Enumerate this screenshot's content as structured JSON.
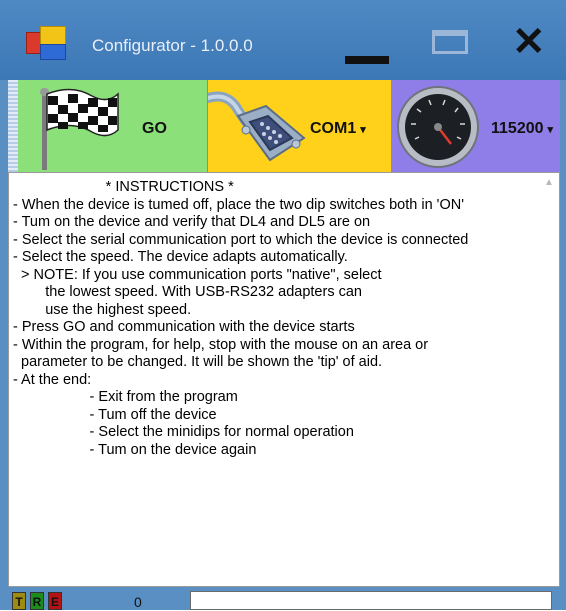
{
  "window": {
    "title": "Configurator - 1.0.0.0",
    "close_glyph": "✕"
  },
  "toolbar": {
    "go_label": "GO",
    "port_label": "COM1",
    "speed_label": "115200",
    "caret": "▾"
  },
  "instructions": {
    "text": "                       * INSTRUCTIONS *\n- When the device is tumed off, place the two dip switches both in 'ON'\n- Tum on the device and verify that DL4 and DL5 are on\n- Select the serial communication port to which the device is connected\n- Select the speed. The device adapts automatically.\n  > NOTE: If you use communication ports \"native\", select\n        the lowest speed. With USB-RS232 adapters can\n        use the highest speed.\n- Press GO and communication with the device starts\n- Within the program, for help, stop with the mouse on an area or\n  parameter to be changed. It will be shown the 'tip' of aid.\n- At the end:\n                   - Exit from the program\n                   - Tum off the device\n                   - Select the minidips for normal operation\n                   - Tum on the device again"
  },
  "statusbar": {
    "led_t": "T",
    "led_r": "R",
    "led_e": "E",
    "counter": "0",
    "field_value": ""
  },
  "icons": {
    "app": "app-icon",
    "flag": "checkered-flag-icon",
    "serial": "serial-connector-icon",
    "gauge": "speed-gauge-icon"
  },
  "colors": {
    "go_segment": "#8be07a",
    "port_segment": "#ffd11a",
    "speed_segment": "#8f7de8",
    "frame": "#5a8fc4"
  }
}
